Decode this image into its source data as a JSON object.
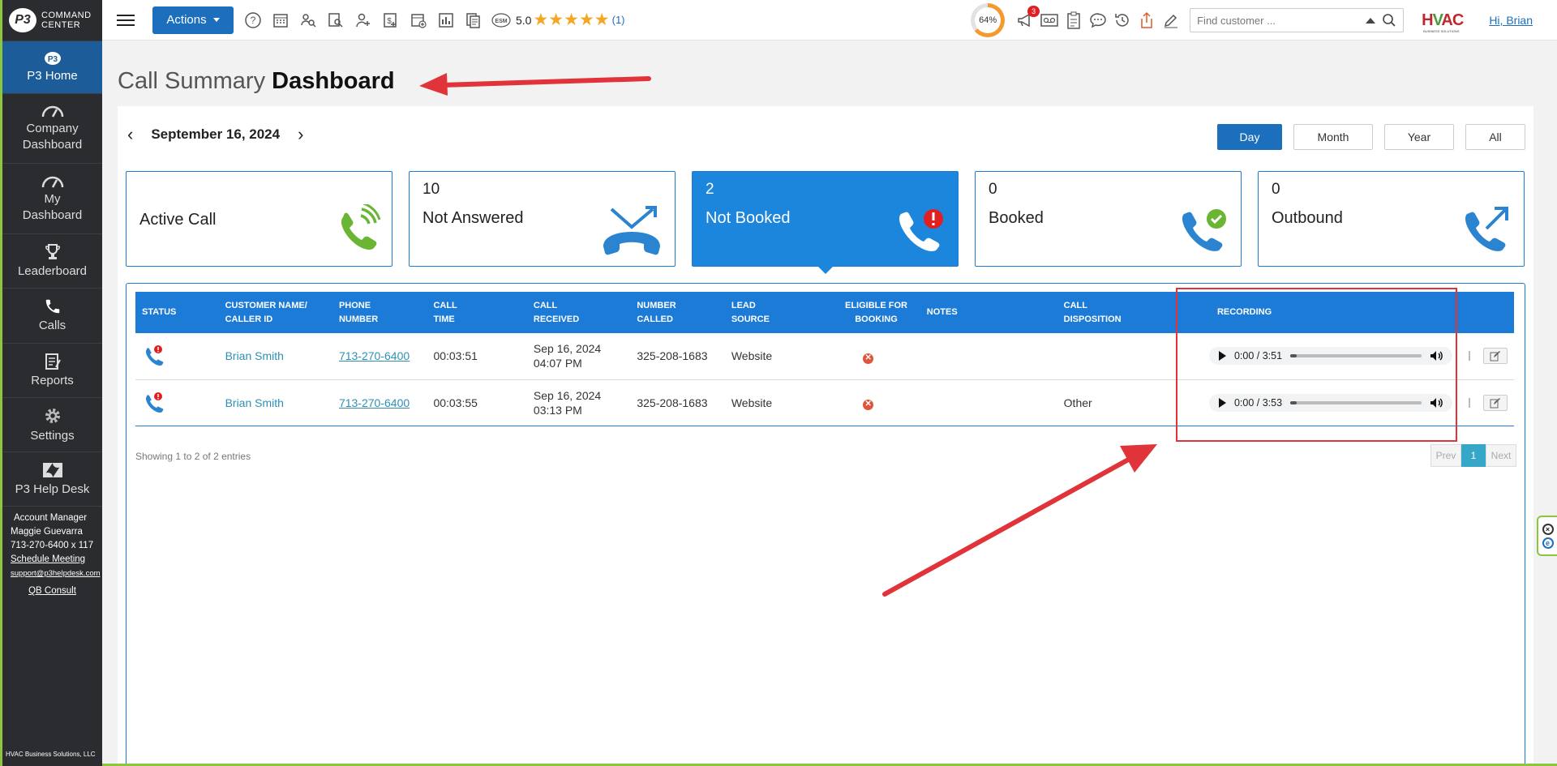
{
  "brand": {
    "logo_mark": "P3",
    "line1": "COMMAND",
    "line2": "CENTER"
  },
  "sidebar": {
    "items": [
      {
        "label": "P3 Home",
        "icon": "p3-home-icon"
      },
      {
        "label": "Company Dashboard",
        "icon": "speedometer-icon"
      },
      {
        "label": "My Dashboard",
        "icon": "speedometer-icon"
      },
      {
        "label": "Leaderboard",
        "icon": "trophy-icon"
      },
      {
        "label": "Calls",
        "icon": "phone-icon"
      },
      {
        "label": "Reports",
        "icon": "report-icon"
      },
      {
        "label": "Settings",
        "icon": "gear-icon"
      },
      {
        "label": "P3 Help Desk",
        "icon": "zendesk-icon"
      }
    ],
    "account": {
      "title": "Account Manager",
      "name": "Maggie Guevarra",
      "phone": "713-270-6400 x 117",
      "schedule": "Schedule Meeting",
      "email": "support@p3helpdesk.com",
      "qb": "QB Consult"
    },
    "footer": "HVAC Business Solutions, LLC"
  },
  "topbar": {
    "actions_label": "Actions",
    "esm_label": "ESM",
    "rating": "5.0",
    "stars": "★★★★★",
    "rating_count": "(1)",
    "gauge": "64%",
    "notif_count": "3",
    "search_placeholder": "Find customer ...",
    "hvac_pre": "H",
    "hvac_v": "V",
    "hvac_post": "AC",
    "hvac_sub": "BUSINESS SOLUTIONS",
    "greeting": "Hi, Brian"
  },
  "main": {
    "title_light": "Call Summary",
    "title_bold": "Dashboard",
    "date": "September 16, 2024",
    "ranges": [
      {
        "label": "Day",
        "active": true
      },
      {
        "label": "Month"
      },
      {
        "label": "Year"
      },
      {
        "label": "All"
      }
    ],
    "cards": [
      {
        "count": "",
        "label": "Active Call"
      },
      {
        "count": "10",
        "label": "Not Answered"
      },
      {
        "count": "2",
        "label": "Not Booked"
      },
      {
        "count": "0",
        "label": "Booked"
      },
      {
        "count": "0",
        "label": "Outbound"
      }
    ],
    "columns": [
      {
        "l1": "STATUS",
        "l2": ""
      },
      {
        "l1": "CUSTOMER NAME/",
        "l2": "CALLER ID"
      },
      {
        "l1": "PHONE",
        "l2": "NUMBER"
      },
      {
        "l1": "CALL",
        "l2": "TIME"
      },
      {
        "l1": "CALL",
        "l2": "RECEIVED"
      },
      {
        "l1": "NUMBER",
        "l2": "CALLED"
      },
      {
        "l1": "LEAD",
        "l2": "SOURCE"
      },
      {
        "l1": "ELIGIBLE FOR",
        "l2": "BOOKING"
      },
      {
        "l1": "NOTES",
        "l2": ""
      },
      {
        "l1": "CALL",
        "l2": "DISPOSITION"
      },
      {
        "l1": "RECORDING",
        "l2": ""
      },
      {
        "l1": "",
        "l2": ""
      }
    ],
    "rows": [
      {
        "name": "Brian Smith",
        "phone": "713-270-6400",
        "time": "00:03:51",
        "date": "Sep 16, 2024",
        "clock": "04:07 PM",
        "called": "325-208-1683",
        "source": "Website",
        "eligible": "✕",
        "notes": "",
        "disposition": "",
        "current": "0:00",
        "duration": "3:51"
      },
      {
        "name": "Brian Smith",
        "phone": "713-270-6400",
        "time": "00:03:55",
        "date": "Sep 16, 2024",
        "clock": "03:13 PM",
        "called": "325-208-1683",
        "source": "Website",
        "eligible": "✕",
        "notes": "",
        "disposition": "Other",
        "current": "0:00",
        "duration": "3:53"
      }
    ],
    "showing": "Showing 1 to 2 of 2 entries",
    "pager": {
      "prev": "Prev",
      "page": "1",
      "next": "Next"
    }
  },
  "colors": {
    "accent": "#1c6fbd",
    "card_border": "#1c7bd6",
    "annotation": "#e0333a",
    "sidebar": "#2a2c2f",
    "green": "#8cc63f"
  }
}
